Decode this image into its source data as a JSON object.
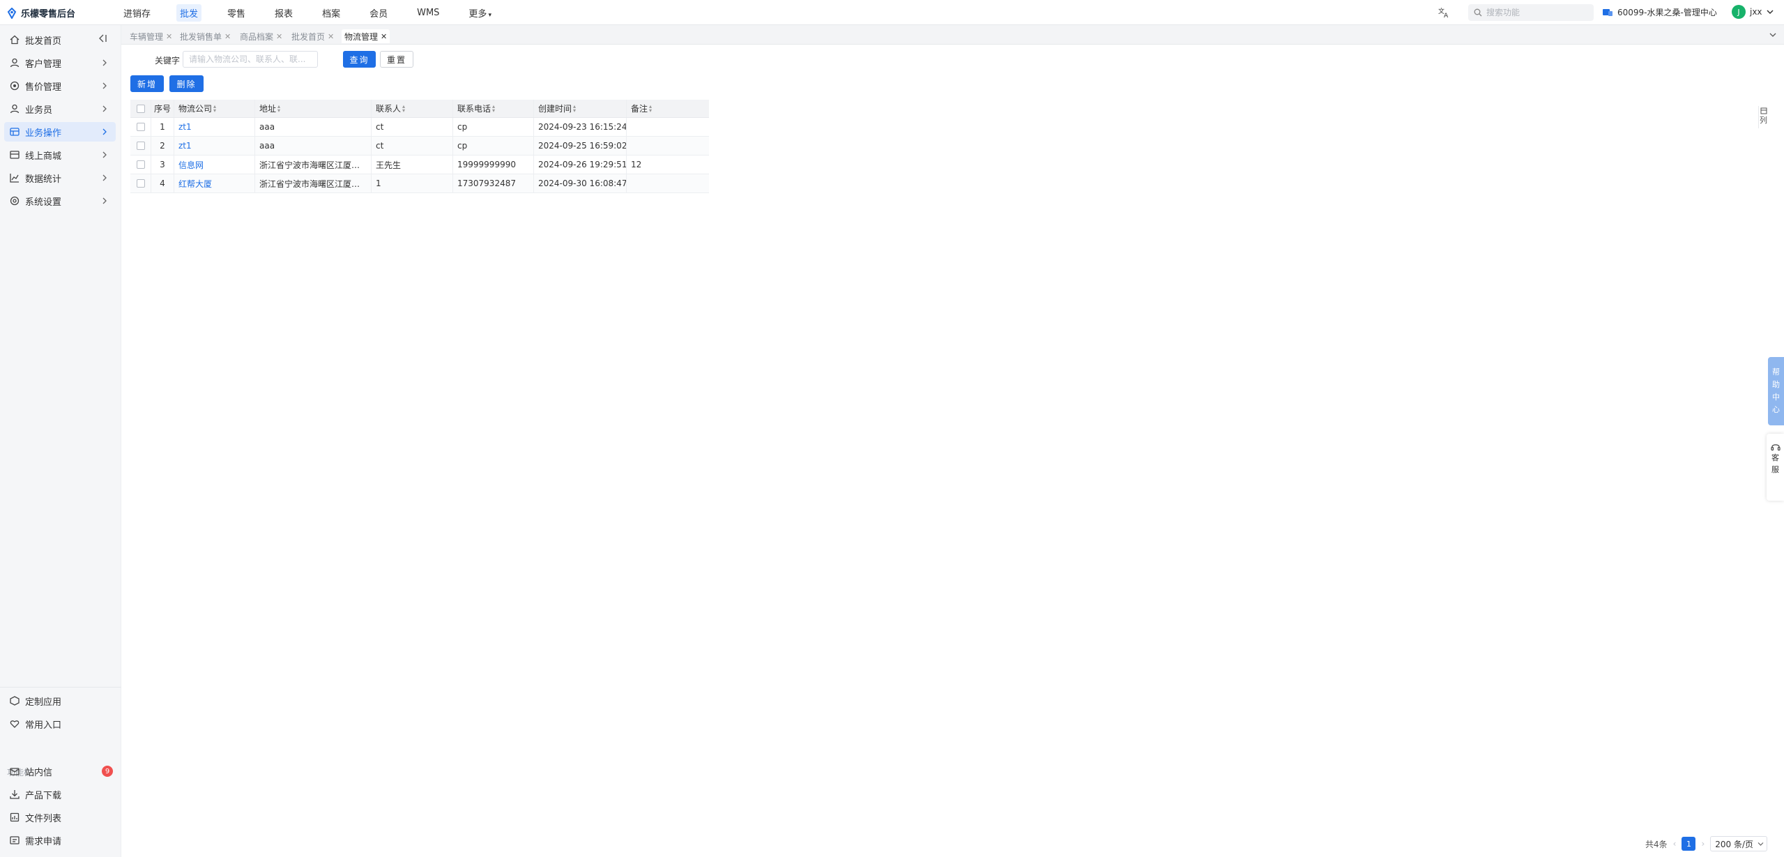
{
  "app": {
    "title": "乐檬零售后台"
  },
  "topnav": {
    "items": [
      {
        "label": "进销存",
        "active": false
      },
      {
        "label": "批发",
        "active": true
      },
      {
        "label": "零售",
        "active": false
      },
      {
        "label": "报表",
        "active": false
      },
      {
        "label": "档案",
        "active": false
      },
      {
        "label": "会员",
        "active": false
      },
      {
        "label": "WMS",
        "active": false
      },
      {
        "label": "更多",
        "active": false
      }
    ],
    "search_placeholder": "搜索功能",
    "store": "60099-水果之桑-管理中心",
    "user_initial": "J",
    "user_name": "jxx"
  },
  "sidebar": {
    "items": [
      {
        "label": "批发首页",
        "icon": "home-icon"
      },
      {
        "label": "客户管理",
        "icon": "user-icon"
      },
      {
        "label": "售价管理",
        "icon": "price-icon"
      },
      {
        "label": "业务员",
        "icon": "person-icon"
      },
      {
        "label": "业务操作",
        "icon": "ops-icon"
      },
      {
        "label": "线上商城",
        "icon": "store-icon"
      },
      {
        "label": "数据统计",
        "icon": "chart-icon"
      },
      {
        "label": "系统设置",
        "icon": "settings-icon"
      }
    ],
    "bottom_items": [
      {
        "label": "定制应用",
        "icon": "cube-icon"
      },
      {
        "label": "常用入口",
        "icon": "heart-icon"
      }
    ],
    "section_label": "功能栏",
    "func_items": [
      {
        "label": "站内信",
        "icon": "mail-icon",
        "badge": "9"
      },
      {
        "label": "产品下载",
        "icon": "download-icon"
      },
      {
        "label": "文件列表",
        "icon": "file-icon"
      },
      {
        "label": "需求申请",
        "icon": "request-icon"
      }
    ]
  },
  "tabs": [
    {
      "label": "车辆管理"
    },
    {
      "label": "批发销售单"
    },
    {
      "label": "商品档案"
    },
    {
      "label": "批发首页"
    },
    {
      "label": "物流管理"
    }
  ],
  "filter": {
    "keyword_label": "关键字",
    "keyword_placeholder": "请输入物流公司、联系人、联...",
    "query_label": "查询",
    "reset_label": "重置"
  },
  "actions": {
    "add_label": "新增",
    "delete_label": "删除"
  },
  "table": {
    "columns": [
      "序号",
      "物流公司",
      "地址",
      "联系人",
      "联系电话",
      "创建时间",
      "备注"
    ],
    "rows": [
      {
        "idx": "1",
        "company": "zt1",
        "address": "aaa",
        "contact": "ct",
        "phone": "cp",
        "created": "2024-09-23 16:15:24",
        "note": ""
      },
      {
        "idx": "2",
        "company": "zt1",
        "address": "aaa",
        "contact": "ct",
        "phone": "cp",
        "created": "2024-09-25 16:59:02",
        "note": ""
      },
      {
        "idx": "3",
        "company": "信息网",
        "address": "浙江省宁波市海曙区江厦街...",
        "contact": "王先生",
        "phone": "19999999990",
        "created": "2024-09-26 19:29:51",
        "note": "12"
      },
      {
        "idx": "4",
        "company": "红帮大厦",
        "address": "浙江省宁波市海曙区江厦街...",
        "contact": "1",
        "phone": "17307932487",
        "created": "2024-09-30 16:08:47",
        "note": ""
      }
    ]
  },
  "right_widgets": {
    "col_setting": "列",
    "help_center": [
      "帮",
      "助",
      "中",
      "心"
    ],
    "service": [
      "客",
      "服"
    ]
  },
  "pagination": {
    "total": "共4条",
    "current": "1",
    "page_size": "200 条/页"
  },
  "colors": {
    "primary": "#1f6fe5",
    "badge": "#f0504f",
    "avatar": "#17b26a"
  }
}
